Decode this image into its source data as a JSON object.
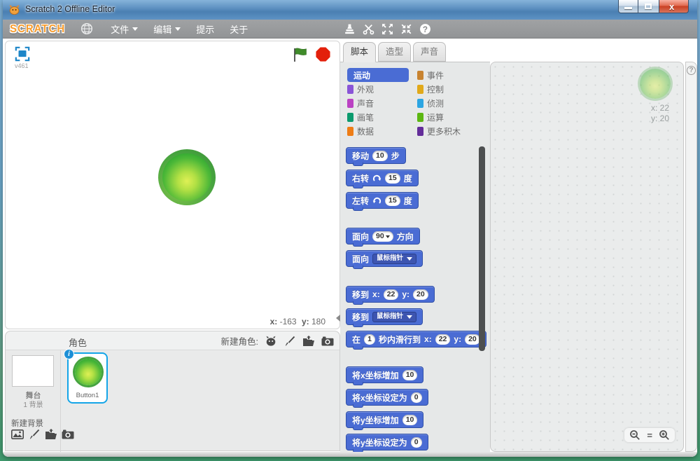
{
  "window": {
    "title": "Scratch 2 Offline Editor",
    "controls": [
      "minimize",
      "maximize",
      "close"
    ]
  },
  "menubar": {
    "logo": "SCRATCH",
    "items": [
      {
        "id": "file",
        "label": "文件",
        "has_arrow": true
      },
      {
        "id": "edit",
        "label": "编辑",
        "has_arrow": true
      },
      {
        "id": "tips",
        "label": "提示",
        "has_arrow": false
      },
      {
        "id": "about",
        "label": "关于",
        "has_arrow": false
      }
    ],
    "toolbar_icons": [
      "stamp-duplicate",
      "scissors-delete",
      "grow-sprite",
      "shrink-sprite",
      "block-help"
    ]
  },
  "stage": {
    "version": "v461",
    "mouse": {
      "x_label": "x:",
      "x": "-163",
      "y_label": "y:",
      "y": "180"
    }
  },
  "sprites_panel": {
    "title": "角色",
    "new_sprite_label": "新建角色:",
    "new_sprite_icons": [
      "sprite-library",
      "paintbrush",
      "upload-folder",
      "camera"
    ],
    "stage_thumb_label": "舞台",
    "stage_thumb_sub": "1 背景",
    "new_backdrop_label": "新建背景",
    "new_backdrop_icons": [
      "backdrop-library",
      "paintbrush",
      "upload-folder",
      "camera"
    ],
    "info_badge": "i",
    "sprites": [
      {
        "name": "Button1",
        "selected": true
      }
    ]
  },
  "palette": {
    "tabs": [
      {
        "id": "scripts",
        "label": "脚本",
        "active": true
      },
      {
        "id": "costumes",
        "label": "造型",
        "active": false
      },
      {
        "id": "sounds",
        "label": "声音",
        "active": false
      }
    ],
    "categories": [
      {
        "id": "motion",
        "label": "运动",
        "color": "#4a6cd4",
        "selected": true
      },
      {
        "id": "looks",
        "label": "外观",
        "color": "#8a55d7",
        "selected": false
      },
      {
        "id": "sound",
        "label": "声音",
        "color": "#bb42c3",
        "selected": false
      },
      {
        "id": "pen",
        "label": "画笔",
        "color": "#0b9a6d",
        "selected": false
      },
      {
        "id": "data",
        "label": "数据",
        "color": "#ee7d16",
        "selected": false
      },
      {
        "id": "events",
        "label": "事件",
        "color": "#c88330",
        "selected": false
      },
      {
        "id": "control",
        "label": "控制",
        "color": "#e1a91a",
        "selected": false
      },
      {
        "id": "sensing",
        "label": "侦测",
        "color": "#2ca5e2",
        "selected": false
      },
      {
        "id": "operators",
        "label": "运算",
        "color": "#5cb712",
        "selected": false
      },
      {
        "id": "more-blocks",
        "label": "更多积木",
        "color": "#632d99",
        "selected": false
      }
    ],
    "block_color": "#4a6cd4",
    "blocks": [
      {
        "id": "move-steps",
        "parts": [
          {
            "t": "label",
            "v": "移动"
          },
          {
            "t": "num",
            "v": "10"
          },
          {
            "t": "label",
            "v": "步"
          }
        ],
        "gap_after": false
      },
      {
        "id": "turn-right",
        "parts": [
          {
            "t": "label",
            "v": "右转"
          },
          {
            "t": "icon",
            "v": "turn-cw"
          },
          {
            "t": "num",
            "v": "15"
          },
          {
            "t": "label",
            "v": "度"
          }
        ],
        "gap_after": false
      },
      {
        "id": "turn-left",
        "parts": [
          {
            "t": "label",
            "v": "左转"
          },
          {
            "t": "icon",
            "v": "turn-ccw"
          },
          {
            "t": "num",
            "v": "15"
          },
          {
            "t": "label",
            "v": "度"
          }
        ],
        "gap_after": true
      },
      {
        "id": "point-direction",
        "parts": [
          {
            "t": "label",
            "v": "面向"
          },
          {
            "t": "numdrop",
            "v": "90"
          },
          {
            "t": "label",
            "v": "方向"
          }
        ],
        "gap_after": false
      },
      {
        "id": "point-towards",
        "parts": [
          {
            "t": "label",
            "v": "面向"
          },
          {
            "t": "drop",
            "v": "鼠标指针"
          }
        ],
        "gap_after": true
      },
      {
        "id": "goto-xy",
        "parts": [
          {
            "t": "label",
            "v": "移到"
          },
          {
            "t": "label",
            "v": "x:"
          },
          {
            "t": "num",
            "v": "22"
          },
          {
            "t": "label",
            "v": "y:"
          },
          {
            "t": "num",
            "v": "20"
          }
        ],
        "gap_after": false
      },
      {
        "id": "goto-mouse",
        "parts": [
          {
            "t": "label",
            "v": "移到"
          },
          {
            "t": "drop",
            "v": "鼠标指针"
          }
        ],
        "gap_after": false
      },
      {
        "id": "glide-to-xy",
        "parts": [
          {
            "t": "label",
            "v": "在"
          },
          {
            "t": "num",
            "v": "1"
          },
          {
            "t": "label",
            "v": "秒内滑行到"
          },
          {
            "t": "label",
            "v": "x:"
          },
          {
            "t": "num",
            "v": "22"
          },
          {
            "t": "label",
            "v": "y:"
          },
          {
            "t": "num",
            "v": "20"
          }
        ],
        "gap_after": true
      },
      {
        "id": "change-x",
        "parts": [
          {
            "t": "label",
            "v": "将x坐标增加"
          },
          {
            "t": "num",
            "v": "10"
          }
        ],
        "gap_after": false
      },
      {
        "id": "set-x",
        "parts": [
          {
            "t": "label",
            "v": "将x坐标设定为"
          },
          {
            "t": "num",
            "v": "0"
          }
        ],
        "gap_after": false
      },
      {
        "id": "change-y",
        "parts": [
          {
            "t": "label",
            "v": "将y坐标增加"
          },
          {
            "t": "num",
            "v": "10"
          }
        ],
        "gap_after": false
      },
      {
        "id": "set-y",
        "parts": [
          {
            "t": "label",
            "v": "将y坐标设定为"
          },
          {
            "t": "num",
            "v": "0"
          }
        ],
        "gap_after": false
      }
    ]
  },
  "script_area": {
    "sprite_x": "x: 22",
    "sprite_y": "y: 20",
    "zoom_icons": [
      "zoom-out",
      "zoom-reset-equal",
      "zoom-in"
    ],
    "zoom_equal": "="
  },
  "glyphs": {
    "help": "?",
    "info": "i"
  },
  "colors": {
    "selection_blue": "#14a5e8",
    "motion_blue": "#4a6cd4",
    "menubar_gray": "#98999b"
  }
}
